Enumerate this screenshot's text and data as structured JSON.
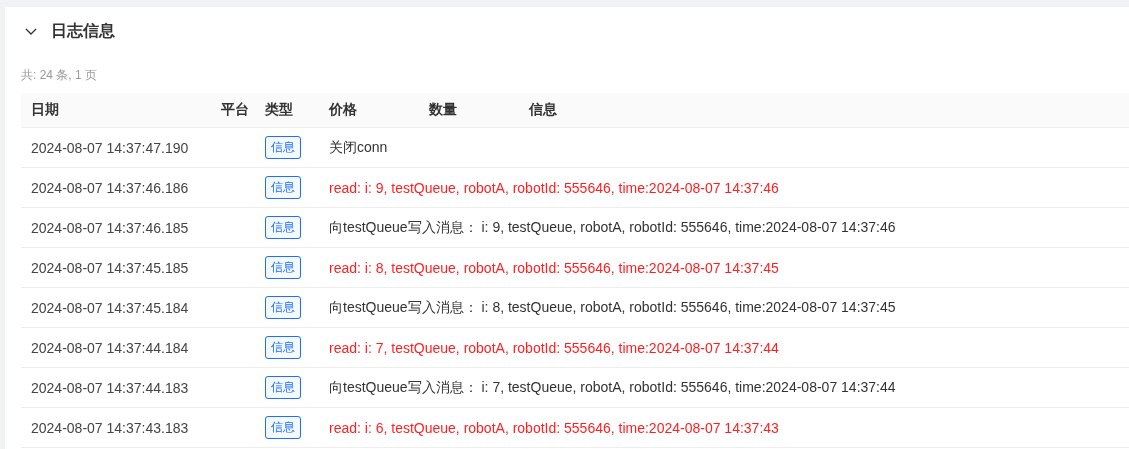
{
  "panel": {
    "title": "日志信息",
    "expanded": true,
    "summary": "共: 24 条, 1 页"
  },
  "table": {
    "columns": [
      "日期",
      "平台",
      "类型",
      "价格",
      "数量",
      "信息"
    ],
    "rows": [
      {
        "date": "2024-08-07 14:37:47.190",
        "type": "信息",
        "message": "关闭conn",
        "color": "#333333"
      },
      {
        "date": "2024-08-07 14:37:46.186",
        "type": "信息",
        "message": "read: i: 9, testQueue, robotA, robotId: 555646, time:2024-08-07 14:37:46",
        "color": "#ff1f1f"
      },
      {
        "date": "2024-08-07 14:37:46.185",
        "type": "信息",
        "message": "向testQueue写入消息：  i: 9, testQueue, robotA, robotId: 555646, time:2024-08-07 14:37:46",
        "color": "#333333"
      },
      {
        "date": "2024-08-07 14:37:45.185",
        "type": "信息",
        "message": "read: i: 8, testQueue, robotA, robotId: 555646, time:2024-08-07 14:37:45",
        "color": "#ff1f1f"
      },
      {
        "date": "2024-08-07 14:37:45.184",
        "type": "信息",
        "message": "向testQueue写入消息：  i: 8, testQueue, robotA, robotId: 555646, time:2024-08-07 14:37:45",
        "color": "#333333"
      },
      {
        "date": "2024-08-07 14:37:44.184",
        "type": "信息",
        "message": "read: i: 7, testQueue, robotA, robotId: 555646, time:2024-08-07 14:37:44",
        "color": "#ff1f1f"
      },
      {
        "date": "2024-08-07 14:37:44.183",
        "type": "信息",
        "message": "向testQueue写入消息：  i: 7, testQueue, robotA, robotId: 555646, time:2024-08-07 14:37:44",
        "color": "#333333"
      },
      {
        "date": "2024-08-07 14:37:43.183",
        "type": "信息",
        "message": "read: i: 6, testQueue, robotA, robotId: 555646, time:2024-08-07 14:37:43",
        "color": "#ff1f1f"
      }
    ]
  }
}
